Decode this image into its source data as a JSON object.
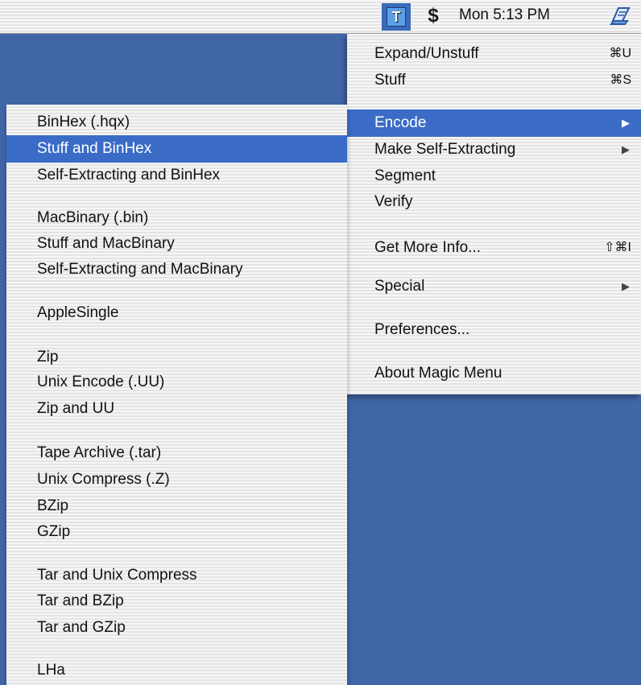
{
  "menubar": {
    "app_icon_letter": "T",
    "dollar_icon": "$",
    "clock": "Mon 5:13 PM"
  },
  "main_menu": {
    "items": [
      {
        "label": "Expand/Unstuff",
        "shortcut": "⌘U"
      },
      {
        "label": "Stuff",
        "shortcut": "⌘S"
      },
      {
        "label": "Encode",
        "submenu_arrow": "▶",
        "highlighted": true
      },
      {
        "label": "Make Self-Extracting",
        "submenu_arrow": "▶"
      },
      {
        "label": "Segment"
      },
      {
        "label": "Verify"
      },
      {
        "label": "Get More Info...",
        "shortcut": "⇧⌘I"
      },
      {
        "label": "Special",
        "submenu_arrow": "▶"
      },
      {
        "label": "Preferences..."
      },
      {
        "label": "About Magic Menu"
      }
    ]
  },
  "encode_submenu": {
    "items": [
      {
        "label": "BinHex (.hqx)"
      },
      {
        "label": "Stuff and BinHex",
        "highlighted": true
      },
      {
        "label": "Self-Extracting and BinHex"
      },
      {
        "label": "MacBinary (.bin)"
      },
      {
        "label": "Stuff and MacBinary"
      },
      {
        "label": "Self-Extracting and MacBinary"
      },
      {
        "label": "AppleSingle"
      },
      {
        "label": "Zip"
      },
      {
        "label": "Unix Encode (.UU)"
      },
      {
        "label": "Zip and UU"
      },
      {
        "label": "Tape Archive (.tar)"
      },
      {
        "label": "Unix Compress (.Z)"
      },
      {
        "label": "BZip"
      },
      {
        "label": "GZip"
      },
      {
        "label": "Tar and Unix Compress"
      },
      {
        "label": "Tar and BZip"
      },
      {
        "label": "Tar and GZip"
      },
      {
        "label": "LHa"
      }
    ]
  },
  "colors": {
    "desktop": "#4166a8",
    "highlight": "#3a6cc7"
  }
}
